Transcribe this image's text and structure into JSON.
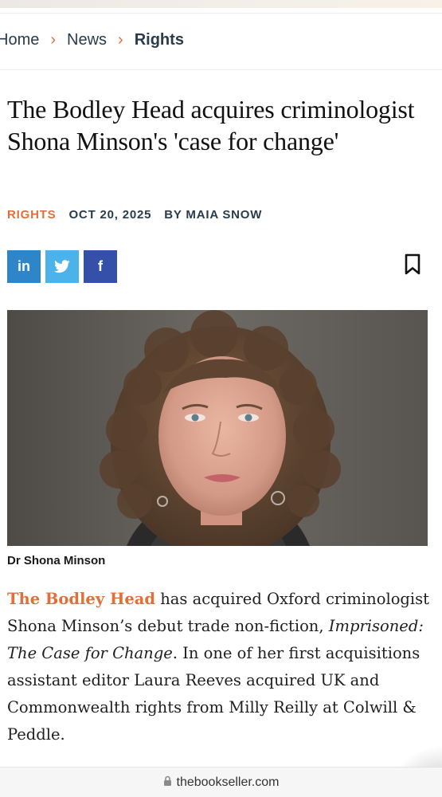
{
  "breadcrumb": {
    "items": [
      "Home",
      "News",
      "Rights"
    ],
    "separator": "›"
  },
  "article": {
    "title": "The Bodley Head acquires criminologist Shona Minson's 'case for change'",
    "category": "RIGHTS",
    "date": "OCT 20, 2025",
    "byline": "BY MAIA SNOW",
    "share": {
      "linkedin_label": "in",
      "twitter_icon": "twitter-bird-icon",
      "facebook_label": "f"
    },
    "bookmark_icon": "bookmark-icon",
    "photo_caption": "Dr Shona Minson",
    "body": {
      "lead_link": "The Bodley Head",
      "text_1": " has acquired Oxford criminologist Shona Minson’s debut trade non-fiction, ",
      "book_title": "Imprisoned: The Case for Change",
      "text_2": ". In one of her first acquisitions assistant editor Laura Reeves acquired UK and Commonwealth rights from Milly Reilly at Colwill & Peddle."
    }
  },
  "browser": {
    "url": "thebookseller.com",
    "lock_icon": "lock-icon"
  },
  "colors": {
    "accent": "#e0703b",
    "nav_text": "#2a3b4c",
    "linkedin": "#2e86c8",
    "twitter": "#4bb3ea",
    "facebook": "#3450a8"
  }
}
